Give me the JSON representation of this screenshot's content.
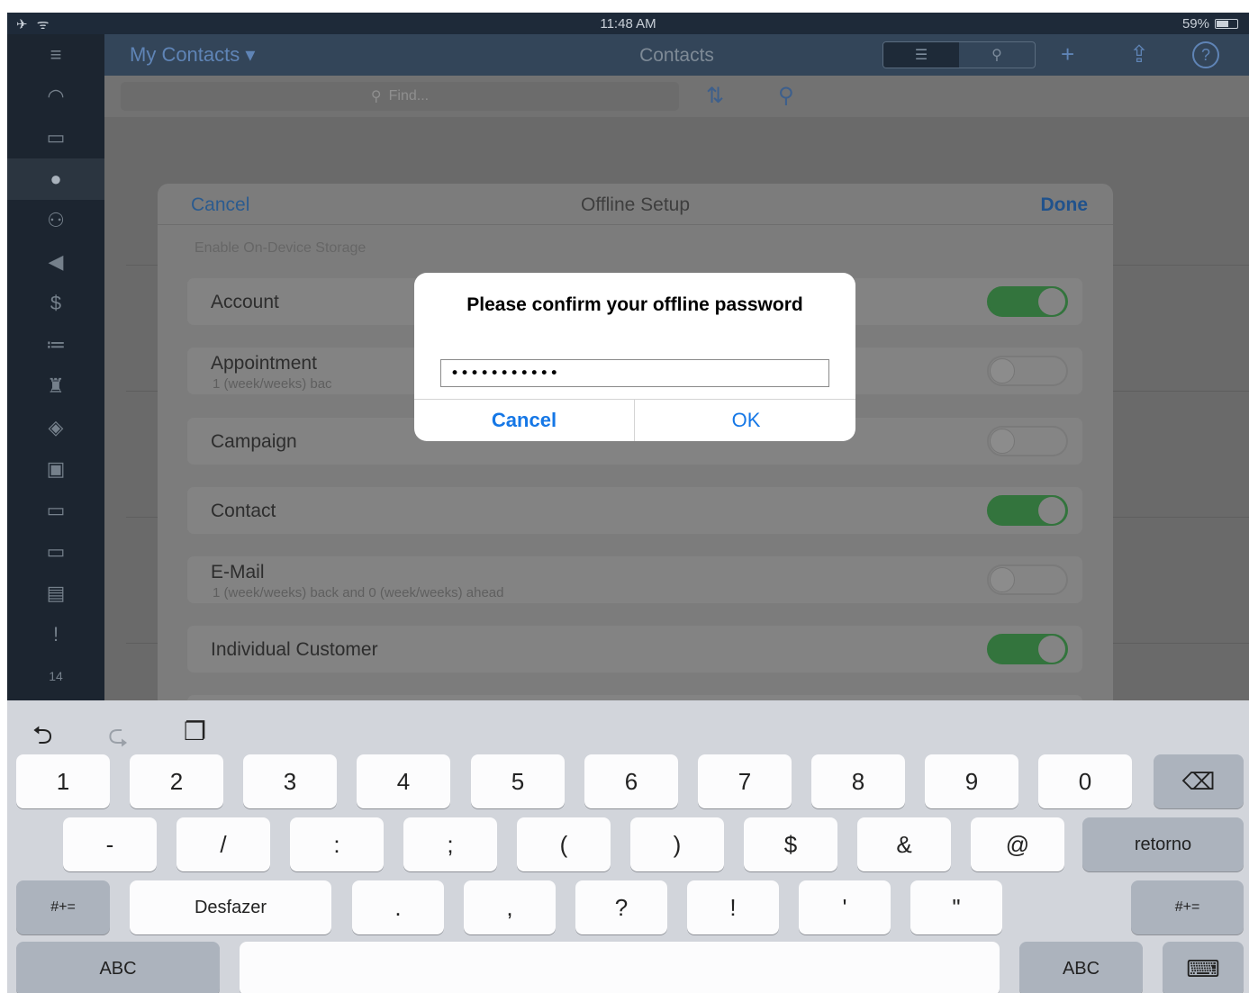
{
  "status_bar": {
    "left": "✈ ᯤ",
    "time": "11:48 AM",
    "battery": "59%"
  },
  "header": {
    "dropdown_label": "My Contacts ▾",
    "title": "Contacts",
    "icon_list": "☰",
    "icon_map_pin": "⚲",
    "icon_add": "+",
    "icon_share": "⇪",
    "icon_help": "?"
  },
  "find_bar": {
    "placeholder": "Find...",
    "icon_search": "⚲",
    "icon_sort": "⇅",
    "icon_zoom": "⚲"
  },
  "sidebar": {
    "items": [
      {
        "icon": "≡"
      },
      {
        "icon": "◠"
      },
      {
        "icon": "▭"
      },
      {
        "icon": "●"
      },
      {
        "icon": "⚇"
      },
      {
        "icon": "◀"
      },
      {
        "icon": "$"
      },
      {
        "icon": "≔"
      },
      {
        "icon": "♜"
      },
      {
        "icon": "◈"
      },
      {
        "icon": "▣"
      },
      {
        "icon": "▭"
      },
      {
        "icon": "▭"
      },
      {
        "icon": "▤"
      },
      {
        "icon": "!"
      },
      {
        "icon": "14"
      }
    ]
  },
  "offline_setup": {
    "cancel_label": "Cancel",
    "title": "Offline Setup",
    "done_label": "Done",
    "section_header": "Enable On-Device Storage",
    "rows": [
      {
        "label": "Account",
        "sub": "",
        "on": true
      },
      {
        "label": "Appointment",
        "sub": "1 (week/weeks) bac",
        "on": false
      },
      {
        "label": "Campaign",
        "sub": "",
        "on": false
      },
      {
        "label": "Contact",
        "sub": "",
        "on": true
      },
      {
        "label": "E-Mail",
        "sub": "1 (week/weeks) back and 0 (week/weeks) ahead",
        "on": false
      },
      {
        "label": "Individual Customer",
        "sub": "",
        "on": true
      }
    ]
  },
  "alert": {
    "message": "Please confirm your offline password",
    "input_value": "•••••••••••",
    "cancel_label": "Cancel",
    "ok_label": "OK"
  },
  "keyboard": {
    "undo_icon": "⮌",
    "redo_icon": "⮎",
    "paste_icon": "❐",
    "row1": [
      "1",
      "2",
      "3",
      "4",
      "5",
      "6",
      "7",
      "8",
      "9",
      "0"
    ],
    "backspace": "⌫",
    "row2": [
      "-",
      "/",
      ":",
      ";",
      "(",
      ")",
      "$",
      "&",
      "@"
    ],
    "return_label": "retorno",
    "shift_left": "#+=",
    "undo_label": "Desfazer",
    "row3": [
      ".",
      ",",
      "?",
      "!",
      "'",
      "\""
    ],
    "shift_right": "#+=",
    "abc_left": "ABC",
    "abc_right": "ABC",
    "hide_keyboard": "⌨"
  }
}
